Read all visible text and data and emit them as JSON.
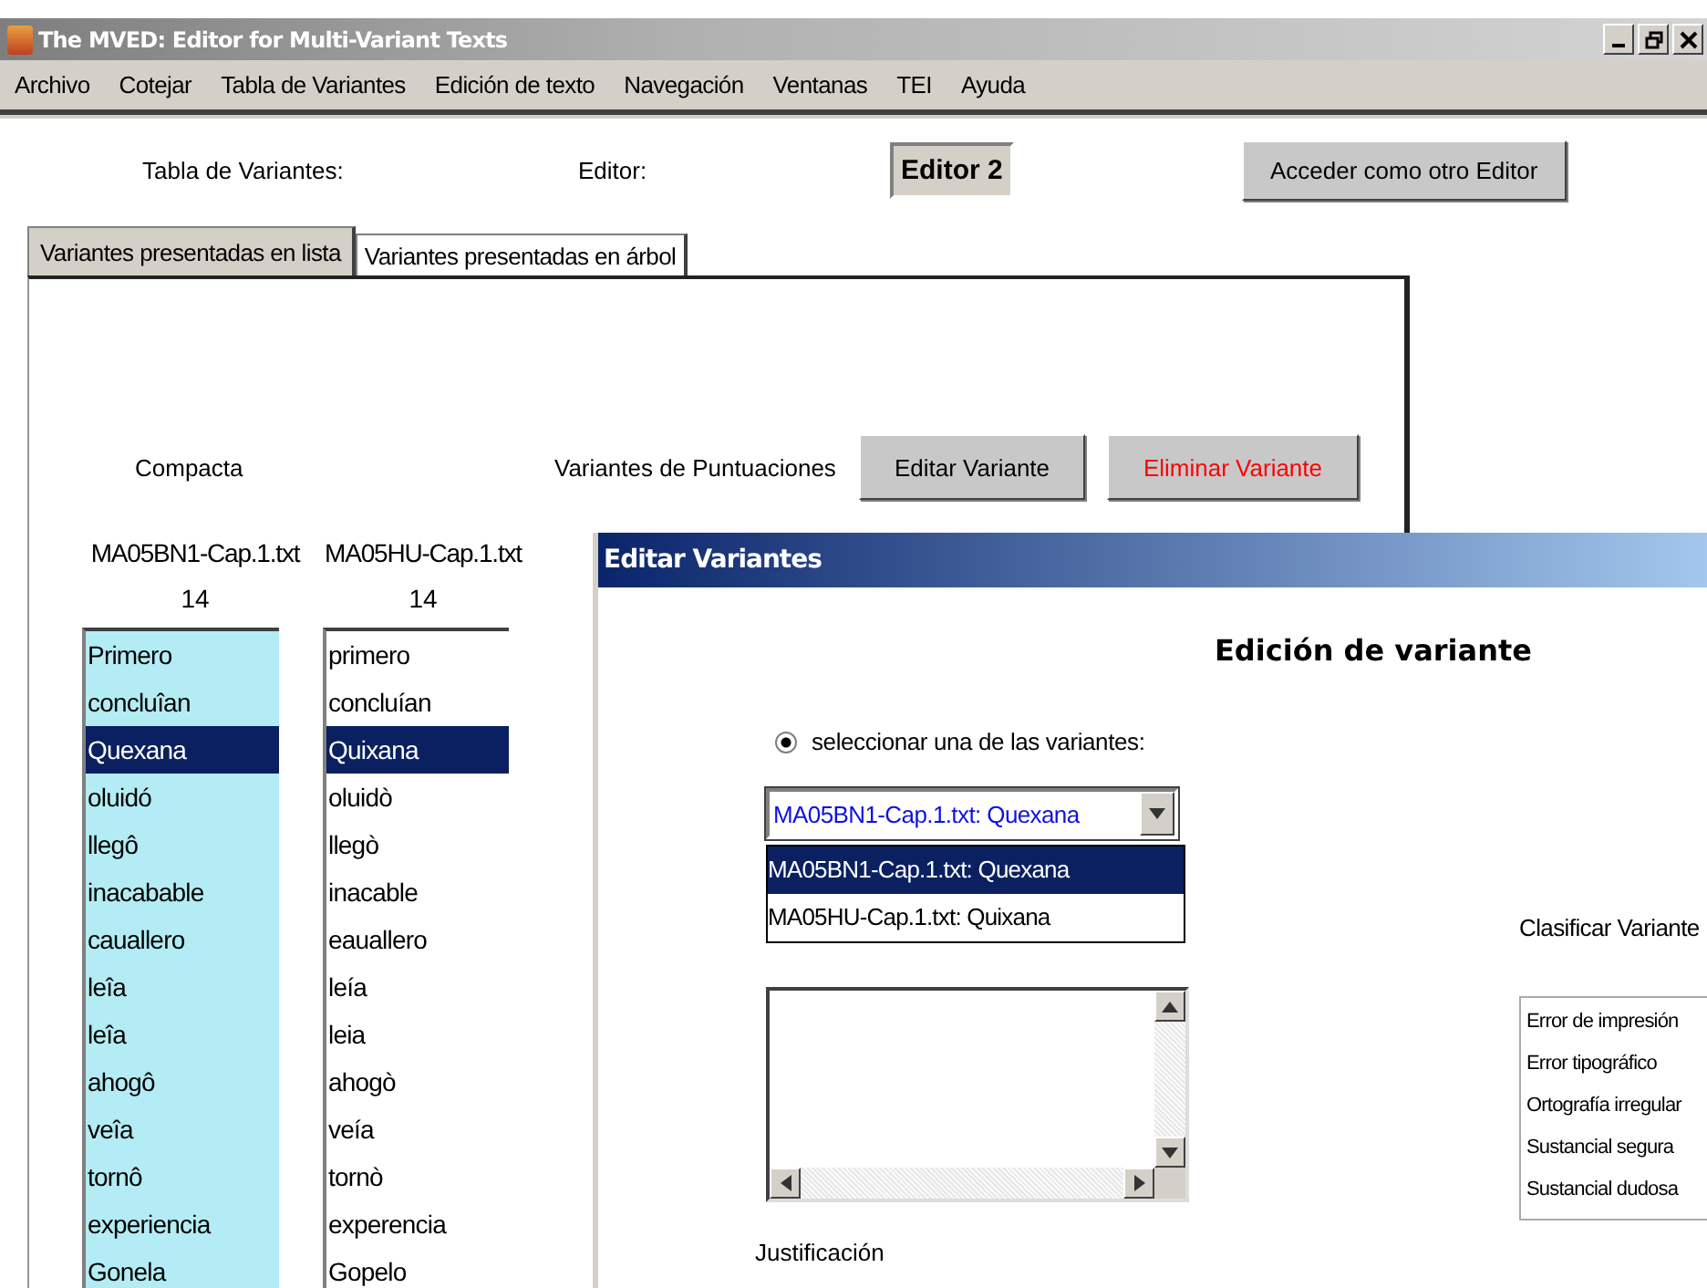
{
  "window": {
    "title": "The MVED: Editor for Multi-Variant Texts"
  },
  "menu": [
    "Archivo",
    "Cotejar",
    "Tabla de Variantes",
    "Edición de texto",
    "Navegación",
    "Ventanas",
    "TEI",
    "Ayuda"
  ],
  "header": {
    "table_label": "Tabla de Variantes:",
    "editor_label": "Editor:",
    "editor_value": "Editor 2",
    "login_button": "Acceder como otro Editor"
  },
  "tabs": [
    {
      "label": "Variantes presentadas en lista",
      "selected": true
    },
    {
      "label": "Variantes presentadas en árbol",
      "selected": false
    }
  ],
  "toolbar": {
    "mode": "Compacta",
    "punctuation": "Variantes de Puntuaciones",
    "buttons": [
      {
        "label": "Editar Variante",
        "kind": "normal"
      },
      {
        "label": "Eliminar Variante",
        "kind": "danger"
      }
    ]
  },
  "columns": [
    {
      "file": "MA05BN1-Cap.1.txt",
      "count": "14",
      "highlighted": true,
      "rows": [
        {
          "text": "Primero",
          "selected": false
        },
        {
          "text": "concluîan",
          "selected": false
        },
        {
          "text": "Quexana",
          "selected": true
        },
        {
          "text": "oluidó",
          "selected": false
        },
        {
          "text": "llegô",
          "selected": false
        },
        {
          "text": "inacabable",
          "selected": false
        },
        {
          "text": "cauallero",
          "selected": false
        },
        {
          "text": "leîa",
          "selected": false
        },
        {
          "text": "leîa",
          "selected": false
        },
        {
          "text": "ahogô",
          "selected": false
        },
        {
          "text": "veîa",
          "selected": false
        },
        {
          "text": "tornô",
          "selected": false
        },
        {
          "text": "experiencia",
          "selected": false
        },
        {
          "text": "Gonela",
          "selected": false
        }
      ]
    },
    {
      "file": "MA05HU-Cap.1.txt",
      "count": "14",
      "highlighted": false,
      "rows": [
        {
          "text": "primero",
          "selected": false
        },
        {
          "text": "concluían",
          "selected": false
        },
        {
          "text": "Quixana",
          "selected": true
        },
        {
          "text": "oluidò",
          "selected": false
        },
        {
          "text": "llegò",
          "selected": false
        },
        {
          "text": "inacable",
          "selected": false
        },
        {
          "text": "eauallero",
          "selected": false
        },
        {
          "text": "leía",
          "selected": false
        },
        {
          "text": "leia",
          "selected": false
        },
        {
          "text": "ahogò",
          "selected": false
        },
        {
          "text": "veía",
          "selected": false
        },
        {
          "text": "tornò",
          "selected": false
        },
        {
          "text": "experencia",
          "selected": false
        },
        {
          "text": "Gopelo",
          "selected": false
        }
      ]
    }
  ],
  "dialog": {
    "title": "Editar Variantes",
    "heading": "Edición de variante",
    "radio": {
      "label": "seleccionar una de las variantes:",
      "checked": true
    },
    "combo": {
      "value": "MA05BN1-Cap.1.txt: Quexana",
      "options": [
        {
          "label": "MA05BN1-Cap.1.txt: Quexana",
          "selected": true
        },
        {
          "label": "MA05HU-Cap.1.txt: Quixana",
          "selected": false
        }
      ]
    },
    "justification_label": "Justificación",
    "classify_label": "Clasificar Variante",
    "classes": [
      "Error de impresión",
      "Error tipográfico",
      "Ortografía irregular",
      "Sustancial segura",
      "Sustancial dudosa"
    ]
  }
}
